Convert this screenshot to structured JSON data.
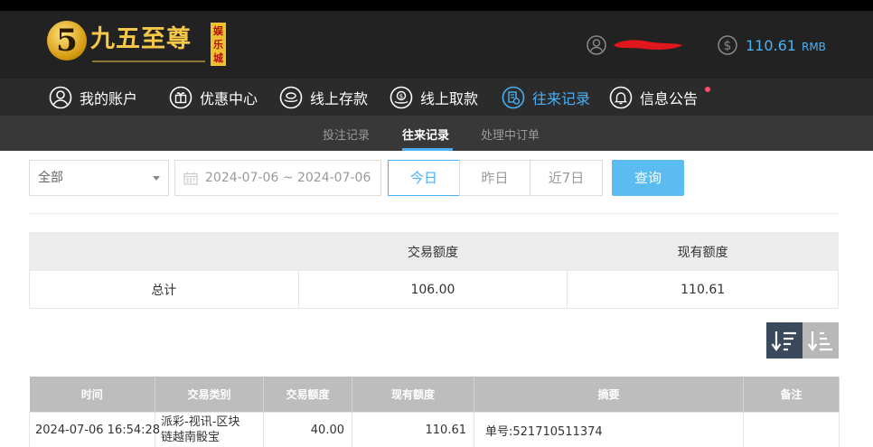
{
  "brand": {
    "logo_digit": "5",
    "name": "九五至尊",
    "sub": "娱乐城",
    "primary_color": "#4ab0f5",
    "gold_color": "#f5c84a"
  },
  "header": {
    "user_icon": "user-circle-icon",
    "coin_icon": "dollar-coin-icon",
    "balance": "110.61",
    "balance_unit": "RMB"
  },
  "nav": {
    "items": [
      {
        "label": "我的账户",
        "icon": "user-circle-icon"
      },
      {
        "label": "优惠中心",
        "icon": "gift-icon"
      },
      {
        "label": "线上存款",
        "icon": "deposit-icon"
      },
      {
        "label": "线上取款",
        "icon": "withdraw-icon"
      },
      {
        "label": "往来记录",
        "icon": "records-icon",
        "active": true
      },
      {
        "label": "信息公告",
        "icon": "bell-icon"
      }
    ]
  },
  "subnav": {
    "items": [
      "投注记录",
      "往来记录",
      "处理中订单"
    ],
    "active_index": 1
  },
  "filters": {
    "type_select": "全部",
    "date_range": "2024-07-06 ~ 2024-07-06",
    "quick": [
      "今日",
      "昨日",
      "近7日"
    ],
    "query_label": "查询"
  },
  "summary": {
    "headers": [
      "",
      "交易额度",
      "现有额度"
    ],
    "row": [
      "总计",
      "106.00",
      "110.61"
    ]
  },
  "records": {
    "headers": [
      "时间",
      "交易类别",
      "交易额度",
      "现有额度",
      "摘要",
      "备注"
    ],
    "rows": [
      {
        "time": "2024-07-06 16:54:28",
        "category_line1": "派彩-视讯-区块",
        "category_line2": "链越南骰宝",
        "amount": "40.00",
        "balance": "110.61",
        "summary": "单号:521710511374",
        "remark": ""
      }
    ]
  }
}
